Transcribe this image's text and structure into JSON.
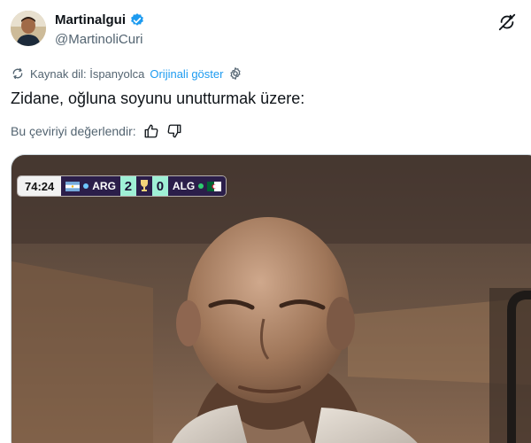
{
  "user": {
    "display_name": "Martinalgui",
    "handle": "@MartinoliCuri"
  },
  "translation": {
    "source_label": "Kaynak dil: İspanyolca",
    "show_original": "Orijinali göster"
  },
  "tweet": {
    "text": "Zidane, oğluna soyunu unutturmak üzere:"
  },
  "rating": {
    "label": "Bu çeviriyi değerlendir:"
  },
  "scorebug": {
    "clock": "74:24",
    "home_team": "ARG",
    "home_score": "2",
    "away_score": "0",
    "away_team": "ALG",
    "colors": {
      "panel": "#2b1e4a",
      "score_bg": "#9ff0d6",
      "home_dot": "#6ec6ff",
      "away_dot": "#2ecc71"
    }
  },
  "icons": {
    "verified": "verified-badge-icon",
    "top_right": "translate-off-icon",
    "translate": "translate-icon",
    "settings": "gear-icon",
    "thumb_up": "thumbs-up-icon",
    "thumb_down": "thumbs-down-icon"
  },
  "colors": {
    "accent": "#1d9bf0",
    "secondary_text": "#536471"
  }
}
